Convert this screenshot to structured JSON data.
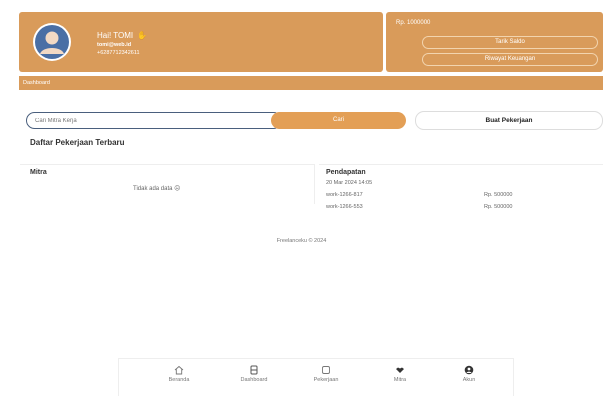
{
  "user_card": {
    "greeting": "Hai! TOMI",
    "greeting_icon": "waving-hand-icon",
    "email": "tomi@web.id",
    "phone": "+6287712342611"
  },
  "saldo_card": {
    "amount": "Rp. 1000000",
    "withdraw_label": "Tarik Saldo",
    "history_label": "Riwayat Keuangan"
  },
  "dashboard_bar": {
    "label": "Dashboard"
  },
  "search": {
    "placeholder": "Cari Mitra Kerja",
    "button_label": "Cari"
  },
  "create_job": {
    "label": "Buat Pekerjaan"
  },
  "section": {
    "title": "Daftar Pekerjaan Terbaru"
  },
  "mitra_panel": {
    "header": "Mitra",
    "empty_text": "Tidak ada data",
    "empty_icon": "frown-face-icon"
  },
  "income_panel": {
    "header": "Pendapatan",
    "date": "20 Mar 2024 14:05",
    "rows": [
      {
        "work": "work-1266-817",
        "amount": "Rp. 500000"
      },
      {
        "work": "work-1266-553",
        "amount": "Rp. 500000"
      }
    ]
  },
  "footer": {
    "text": "Freelanceku © 2024"
  },
  "bottom_nav": {
    "items": [
      {
        "label": "Beranda",
        "icon": "home-icon"
      },
      {
        "label": "Dashboard",
        "icon": "dashboard-icon"
      },
      {
        "label": "Pekerjaan",
        "icon": "briefcase-icon"
      },
      {
        "label": "Mitra",
        "icon": "handshake-icon"
      },
      {
        "label": "Akun",
        "icon": "user-icon"
      }
    ]
  },
  "colors": {
    "accent": "#d99b5a",
    "button_orange": "#e39f56",
    "avatar_blue": "#4a6fa5"
  }
}
